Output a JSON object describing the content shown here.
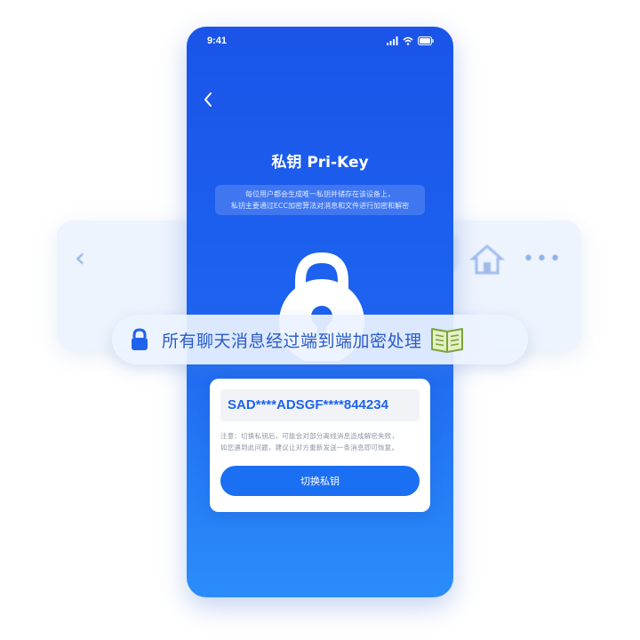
{
  "status_bar": {
    "time": "9:41"
  },
  "page": {
    "title": "私钥 Pri-Key",
    "description_lines": [
      "每位用户都会生成唯一私钥并储存在该设备上，",
      "私钥主要通过ECC加密算法对消息和文件进行加密和解密"
    ]
  },
  "banner": {
    "text": "所有聊天消息经过端到端加密处理"
  },
  "card": {
    "key_value": "SAD****ADSGF****844234",
    "note_lines": [
      "注意：切换私钥后，可能会对部分离线消息造成解密失败，",
      "如您遇到此问题，建议让对方重新发送一条消息即可恢复。"
    ],
    "switch_button_label": "切换私钥"
  },
  "colors": {
    "phone_top": "#1a54e8",
    "phone_bottom": "#2b8df9",
    "accent": "#1a6ff3",
    "banner_text": "#2a5bc9"
  },
  "icons": [
    "back-arrow-icon",
    "signal-icon",
    "wifi-icon",
    "battery-icon",
    "lock-icon",
    "book-icon",
    "home-icon",
    "more-icon"
  ]
}
